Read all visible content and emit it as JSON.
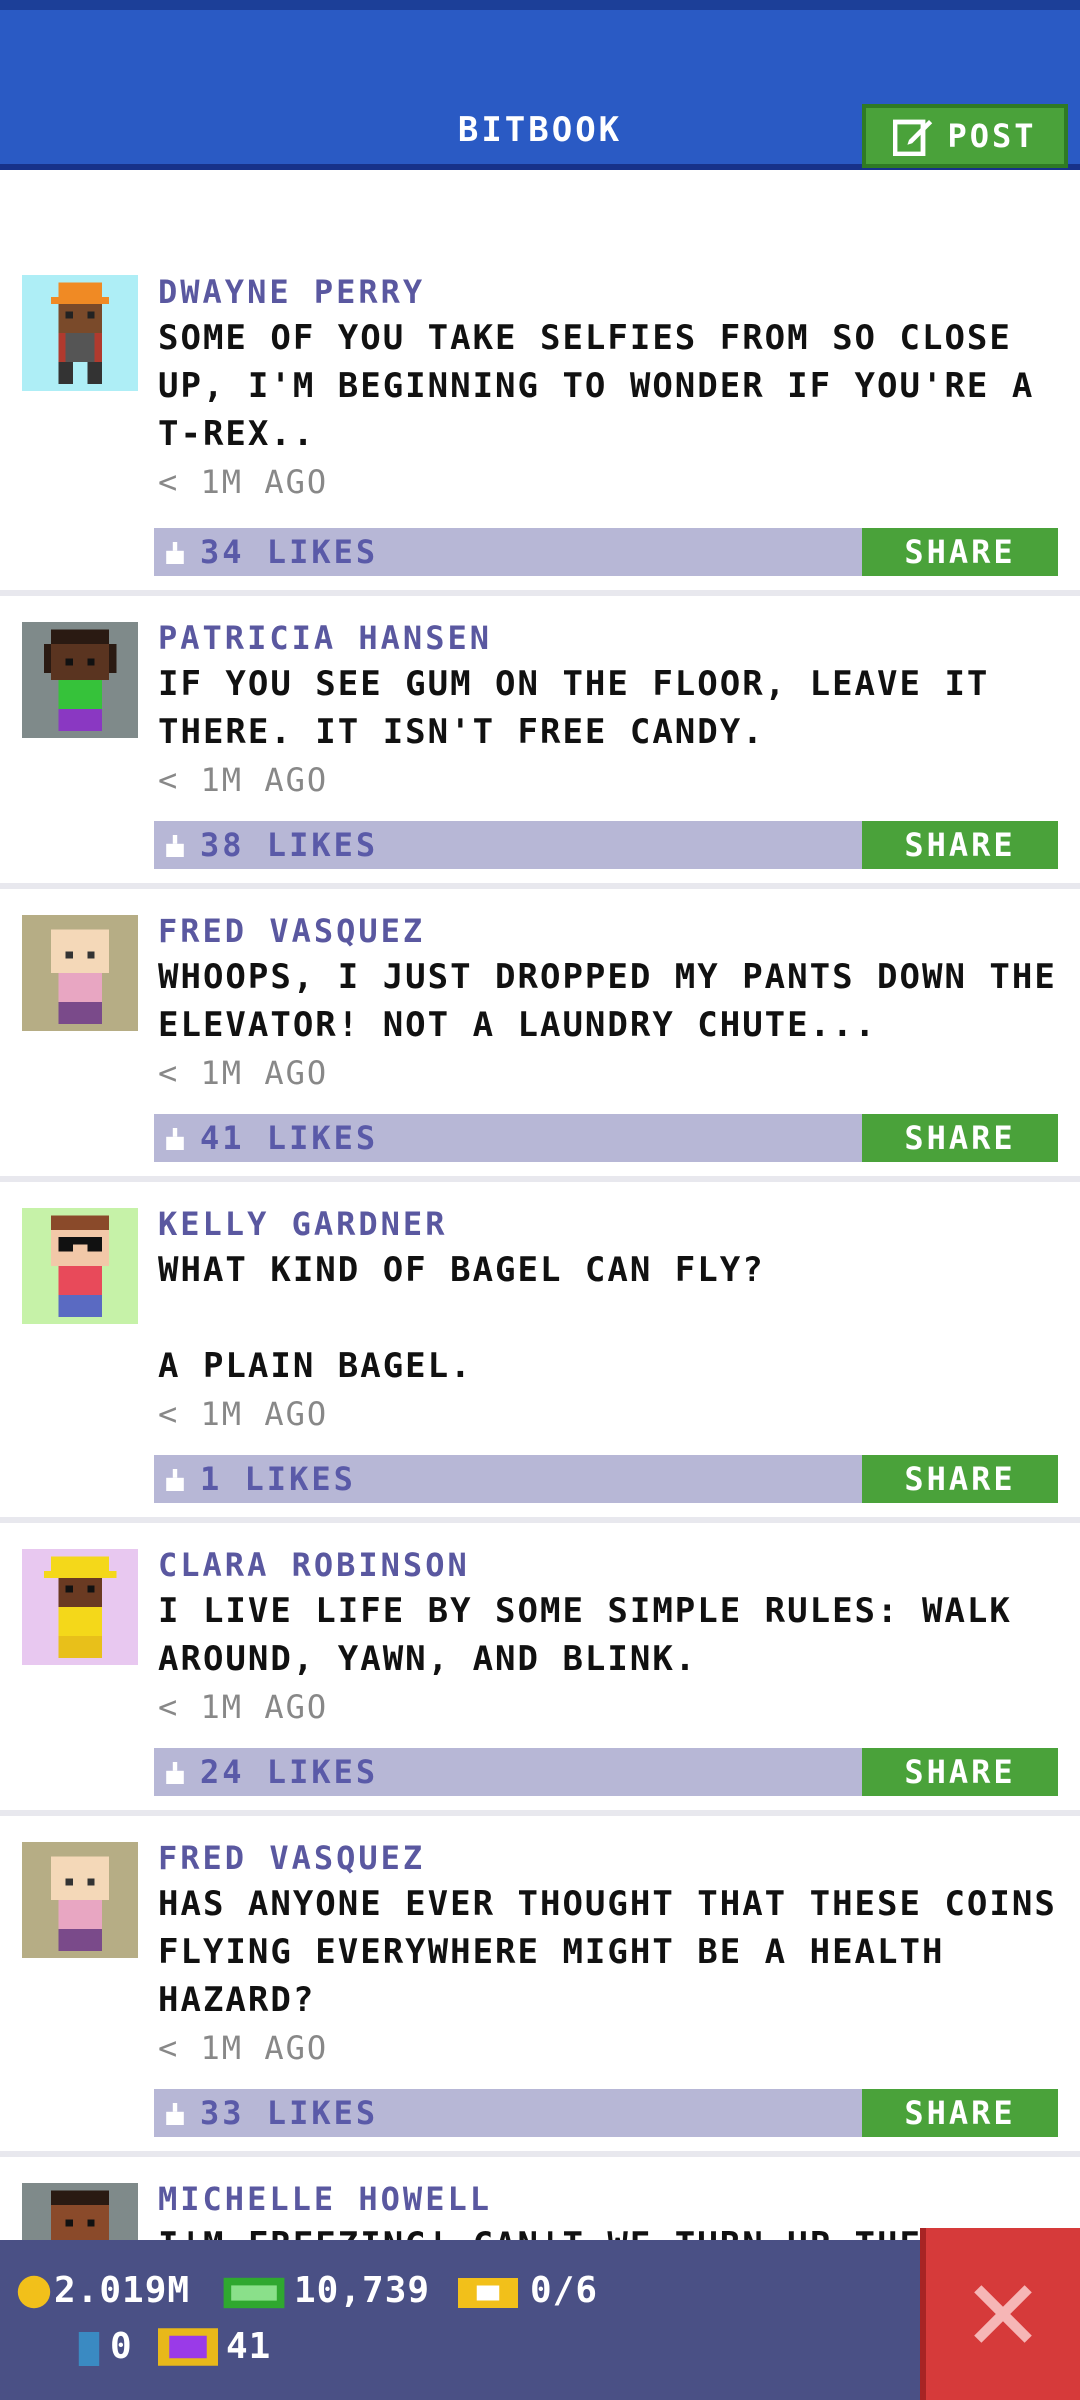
{
  "header": {
    "title": "BITBOOK",
    "post_label": "POST"
  },
  "colors": {
    "header": "#2a5ac4",
    "share": "#4aa23a",
    "likebar": "#b7b7d6",
    "author": "#5a58a0",
    "close": "#d63a3a"
  },
  "share_label": "SHARE",
  "posts": [
    {
      "author": "DWAYNE PERRY",
      "text": "SOME OF YOU TAKE SELFIES FROM SO CLOSE UP, I'M BEGINNING TO WONDER IF YOU'RE A T-REX..",
      "time": "< 1M AGO",
      "likes": "34 LIKES",
      "avatar": "construction-worker"
    },
    {
      "author": "PATRICIA HANSEN",
      "text": "IF YOU SEE GUM ON THE FLOOR, LEAVE IT THERE. IT ISN'T FREE CANDY.",
      "time": "< 1M AGO",
      "likes": "38 LIKES",
      "avatar": "woman-dark"
    },
    {
      "author": "FRED VASQUEZ",
      "text": "WHOOPS, I JUST DROPPED MY PANTS DOWN THE ELEVATOR! NOT A LAUNDRY CHUTE...",
      "time": "< 1M AGO",
      "likes": "41 LIKES",
      "avatar": "bald-man"
    },
    {
      "author": "KELLY GARDNER",
      "text": "WHAT KIND OF BAGEL CAN FLY?\n\nA PLAIN BAGEL.",
      "time": "< 1M AGO",
      "likes": "1 LIKES",
      "avatar": "glasses-woman"
    },
    {
      "author": "CLARA ROBINSON",
      "text": "I LIVE LIFE BY SOME SIMPLE RULES: WALK AROUND, YAWN, AND BLINK.",
      "time": "< 1M AGO",
      "likes": "24 LIKES",
      "avatar": "yellow-hat"
    },
    {
      "author": "FRED VASQUEZ",
      "text": "HAS ANYONE EVER THOUGHT THAT THESE COINS FLYING EVERYWHERE MIGHT BE A HEALTH HAZARD?",
      "time": "< 1M AGO",
      "likes": "33 LIKES",
      "avatar": "bald-man"
    },
    {
      "author": "MICHELLE HOWELL",
      "text": "I'M FREEZING! CAN'T WE TURN UP THE H",
      "time": "",
      "likes": "",
      "avatar": "woman-dark"
    }
  ],
  "status": {
    "coins": "2.019M",
    "bux": "10,739",
    "tickets": "0/6",
    "keys": "0",
    "gifts": "41"
  }
}
